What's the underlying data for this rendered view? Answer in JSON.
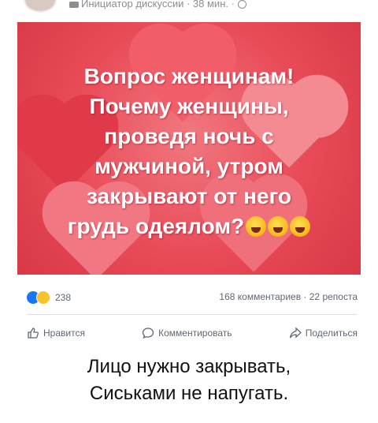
{
  "post": {
    "meta_text": "Инициатор дискуссии · 38 мин. ·",
    "image_lines": [
      "Вопрос женщинам!",
      "Почему женщины,",
      "проведя ночь с",
      "мужчиной, утром",
      "закрывают от него",
      "грудь одеялом?"
    ],
    "image_emojis": [
      "laughing-tears-emoji",
      "laughing-tears-emoji",
      "laughing-tears-emoji"
    ],
    "reaction_count": "238",
    "comments_shares": "168 комментариев · 22 репоста"
  },
  "actions": {
    "like_label": "Нравится",
    "comment_label": "Комментировать",
    "share_label": "Поделиться"
  },
  "caption": {
    "line1": "Лицо нужно закрывать,",
    "line2": "Сиськами не напугать."
  },
  "colors": {
    "image_bg": "#e84a57",
    "like_blue": "#1877f2",
    "meta_gray": "#8a8d91"
  }
}
